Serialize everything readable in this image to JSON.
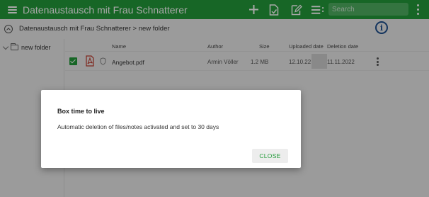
{
  "app": {
    "title": "Datenaustausch mit Frau Schnatterer",
    "accent_color": "#239b3a"
  },
  "toolbar": {
    "menu_icon": "hamburger-menu-icon",
    "tools": [
      "add-icon",
      "upload-file-icon",
      "edit-note-icon",
      "list-view-icon"
    ],
    "search_placeholder": "Search",
    "more_icon": "kebab-menu-icon"
  },
  "breadcrumb": {
    "text": "Datenaustausch mit Frau Schnatterer > new folder"
  },
  "tree": {
    "items": [
      {
        "label": "new folder"
      }
    ]
  },
  "table": {
    "headers": {
      "name": "Name",
      "author": "Author",
      "size": "Size",
      "uploaded": "Uploaded date",
      "deletion": "Deletion date"
    },
    "rows": [
      {
        "selected": true,
        "name": "Angebot.pdf",
        "author": "Armin Völler",
        "size": "1.2 MB",
        "uploaded": "12.10.22",
        "deletion": "11.11.2022"
      }
    ]
  },
  "dialog": {
    "title": "Box time to live",
    "message": "Automatic deletion of files/notes activated and set to 30 days",
    "close_label": "CLOSE"
  }
}
